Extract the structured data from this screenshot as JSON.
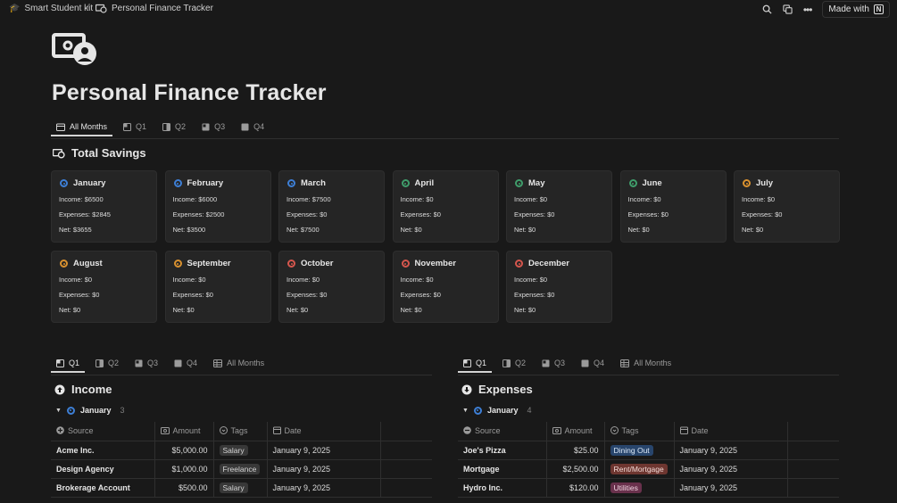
{
  "topbar": {
    "workspace": "Smart Student kit",
    "page": "Personal Finance Tracker",
    "made_with": "Made with",
    "notion_letter": "N"
  },
  "title": "Personal Finance Tracker",
  "top_tabs": [
    "All Months",
    "Q1",
    "Q2",
    "Q3",
    "Q4"
  ],
  "savings_title": "Total Savings",
  "months": [
    {
      "name": "January",
      "color": "#3d7fd6",
      "income": "Income: $6500",
      "expenses": "Expenses: $2845",
      "net": "Net: $3655"
    },
    {
      "name": "February",
      "color": "#3d7fd6",
      "income": "Income: $6000",
      "expenses": "Expenses: $2500",
      "net": "Net: $3500"
    },
    {
      "name": "March",
      "color": "#3d7fd6",
      "income": "Income: $7500",
      "expenses": "Expenses: $0",
      "net": "Net: $7500"
    },
    {
      "name": "April",
      "color": "#3f9d6b",
      "income": "Income: $0",
      "expenses": "Expenses: $0",
      "net": "Net: $0"
    },
    {
      "name": "May",
      "color": "#3f9d6b",
      "income": "Income: $0",
      "expenses": "Expenses: $0",
      "net": "Net: $0"
    },
    {
      "name": "June",
      "color": "#3f9d6b",
      "income": "Income: $0",
      "expenses": "Expenses: $0",
      "net": "Net: $0"
    },
    {
      "name": "July",
      "color": "#d9912f",
      "income": "Income: $0",
      "expenses": "Expenses: $0",
      "net": "Net: $0"
    },
    {
      "name": "August",
      "color": "#d9912f",
      "income": "Income: $0",
      "expenses": "Expenses: $0",
      "net": "Net: $0"
    },
    {
      "name": "September",
      "color": "#d9912f",
      "income": "Income: $0",
      "expenses": "Expenses: $0",
      "net": "Net: $0"
    },
    {
      "name": "October",
      "color": "#d5564d",
      "income": "Income: $0",
      "expenses": "Expenses: $0",
      "net": "Net: $0"
    },
    {
      "name": "November",
      "color": "#d5564d",
      "income": "Income: $0",
      "expenses": "Expenses: $0",
      "net": "Net: $0"
    },
    {
      "name": "December",
      "color": "#d5564d",
      "income": "Income: $0",
      "expenses": "Expenses: $0",
      "net": "Net: $0"
    }
  ],
  "lower_tabs": [
    "Q1",
    "Q2",
    "Q3",
    "Q4",
    "All Months"
  ],
  "income": {
    "title": "Income",
    "group": "January",
    "count": "3",
    "columns": [
      "Source",
      "Amount",
      "Tags",
      "Date"
    ],
    "rows": [
      {
        "source": "Acme Inc.",
        "amount": "$5,000.00",
        "tag": "Salary",
        "tag_bg": "#383838",
        "tag_fg": "#d4d4d4",
        "date": "January 9, 2025"
      },
      {
        "source": "Design Agency",
        "amount": "$1,000.00",
        "tag": "Freelance",
        "tag_bg": "#383838",
        "tag_fg": "#d4d4d4",
        "date": "January 9, 2025"
      },
      {
        "source": "Brokerage Account",
        "amount": "$500.00",
        "tag": "Salary",
        "tag_bg": "#383838",
        "tag_fg": "#d4d4d4",
        "date": "January 9, 2025"
      }
    ]
  },
  "expenses": {
    "title": "Expenses",
    "group": "January",
    "count": "4",
    "columns": [
      "Source",
      "Amount",
      "Tags",
      "Date"
    ],
    "rows": [
      {
        "source": "Joe's Pizza",
        "amount": "$25.00",
        "tag": "Dining Out",
        "tag_bg": "#28456c",
        "tag_fg": "#dbe8f7",
        "date": "January 9, 2025"
      },
      {
        "source": "Mortgage",
        "amount": "$2,500.00",
        "tag": "Rent/Mortgage",
        "tag_bg": "#6e3630",
        "tag_fg": "#f2dad6",
        "date": "January 9, 2025"
      },
      {
        "source": "Hydro Inc.",
        "amount": "$120.00",
        "tag": "Utilities",
        "tag_bg": "#69314c",
        "tag_fg": "#f2d6e3",
        "date": "January 9, 2025"
      }
    ]
  }
}
